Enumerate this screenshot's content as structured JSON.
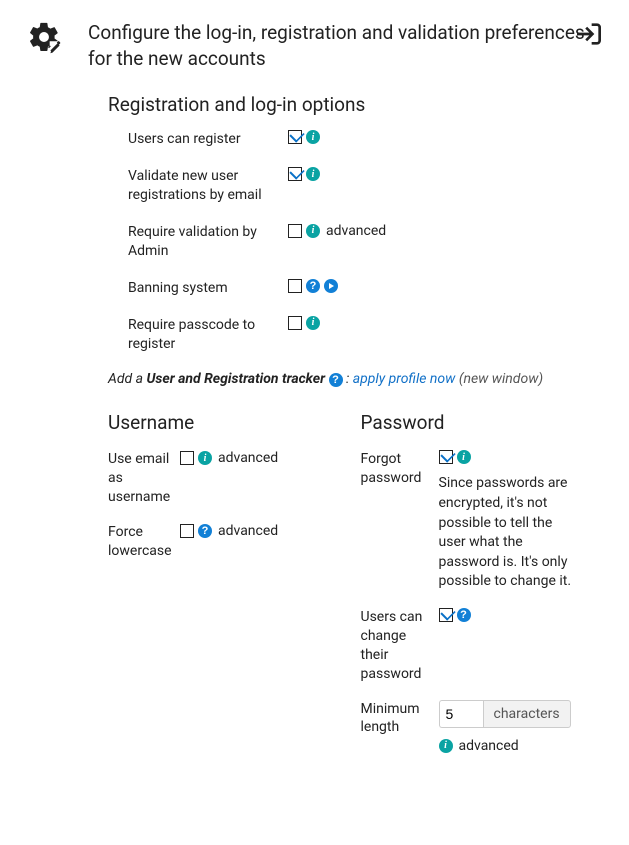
{
  "header": {
    "title": "Configure the log-in, registration and validation preferences for the new accounts"
  },
  "section_registration": {
    "title": "Registration and log-in options",
    "opts": {
      "users_register": {
        "label": "Users can register",
        "checked": true
      },
      "validate_email": {
        "label": "Validate new user registrations by email",
        "checked": true
      },
      "require_admin": {
        "label": "Require validation by Admin",
        "checked": false,
        "suffix": "advanced"
      },
      "banning": {
        "label": "Banning system",
        "checked": false
      },
      "passcode": {
        "label": "Require passcode to register",
        "checked": false
      }
    }
  },
  "tracker": {
    "prefix": "Add a ",
    "bold": "User and Registration tracker",
    "colon": " : ",
    "link": "apply profile now",
    "suffix": "(new window)"
  },
  "username": {
    "title": "Username",
    "email_as_username": {
      "label": "Use email as username",
      "checked": false,
      "suffix": "advanced"
    },
    "force_lowercase": {
      "label": "Force lowercase",
      "checked": false,
      "suffix": "advanced"
    }
  },
  "password": {
    "title": "Password",
    "forgot": {
      "label": "Forgot password",
      "checked": true,
      "desc": "Since passwords are encrypted, it's not possible to tell the user what the password is. It's only possible to change it."
    },
    "users_change": {
      "label": "Users can change their password",
      "checked": true
    },
    "min_length": {
      "label": "Minimum length",
      "value": "5",
      "unit": "characters",
      "suffix": "advanced"
    }
  }
}
